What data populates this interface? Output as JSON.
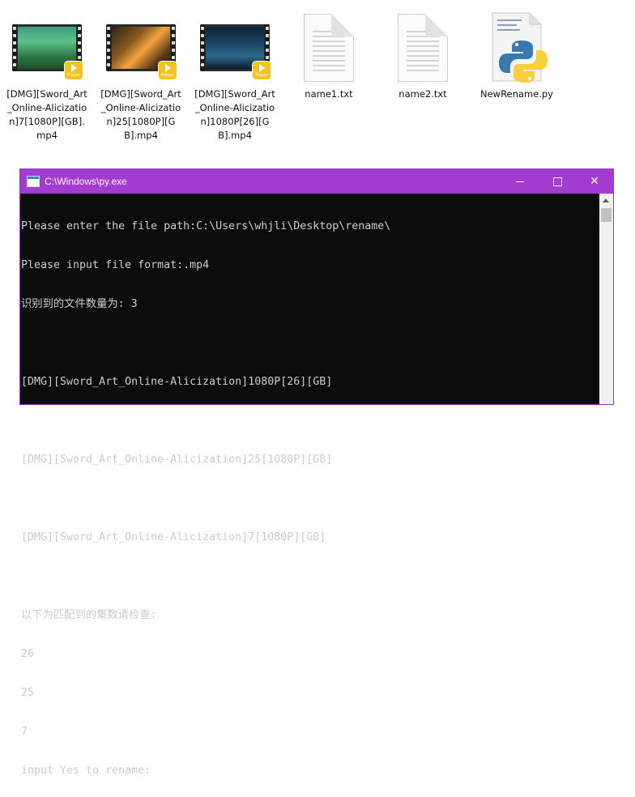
{
  "desktop": {
    "files": [
      {
        "name": "[DMG][Sword_Art_Online-Alicization]7[1080P][GB].mp4",
        "icon": "video-file-icon"
      },
      {
        "name": "[DMG][Sword_Art_Online-Alicization]25[1080P][GB].mp4",
        "icon": "video-file-icon"
      },
      {
        "name": "[DMG][Sword_Art_Online-Alicization]1080P[26][GB].mp4",
        "icon": "video-file-icon"
      },
      {
        "name": "name1.txt",
        "icon": "text-file-icon"
      },
      {
        "name": "name2.txt",
        "icon": "text-file-icon"
      },
      {
        "name": "NewRename.py",
        "icon": "python-file-icon"
      }
    ],
    "player_badge": "Player"
  },
  "console": {
    "title": "C:\\Windows\\py.exe",
    "controls": {
      "minimize": "minimize-icon",
      "maximize": "maximize-icon",
      "close": "✕"
    },
    "lines": [
      "Please enter the file path:C:\\Users\\whjli\\Desktop\\rename\\",
      "Please input file format:.mp4",
      "识别到的文件数量为: 3",
      "",
      "[DMG][Sword_Art_Online-Alicization]1080P[26][GB]",
      "",
      "[DMG][Sword_Art_Online-Alicization]25[1080P][GB]",
      "",
      "[DMG][Sword_Art_Online-Alicization]7[1080P][GB]",
      "",
      "以下为匹配到的集数请检查:",
      "26",
      "25",
      "7",
      "input Yes to rename:"
    ]
  },
  "colors": {
    "titlebar": "#a43bd0",
    "console_bg": "#0c0c0c",
    "console_text": "#cccccc",
    "player_badge": "#f6c21c"
  }
}
